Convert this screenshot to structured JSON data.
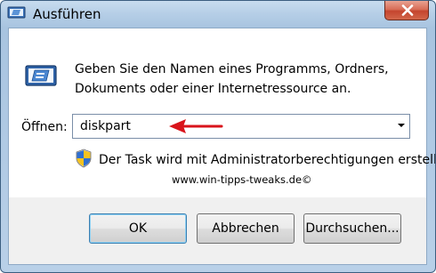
{
  "window": {
    "title": "Ausführen",
    "close_icon": "close-icon",
    "app_icon": "run-app-icon"
  },
  "main": {
    "description": "Geben Sie den Namen eines Programms, Ordners, Dokuments oder einer Internetressource an.",
    "open_label": "Öffnen:",
    "open_value": "diskpart",
    "admin_notice": "Der Task wird mit Administratorberechtigungen erstellt.",
    "watermark": "www.win-tipps-tweaks.de©"
  },
  "buttons": {
    "ok": "OK",
    "cancel": "Abbrechen",
    "browse": "Durchsuchen..."
  },
  "colors": {
    "accent_arrow": "#d9141b",
    "titlebar": "#b6cfe7",
    "close_button": "#c4452e"
  }
}
